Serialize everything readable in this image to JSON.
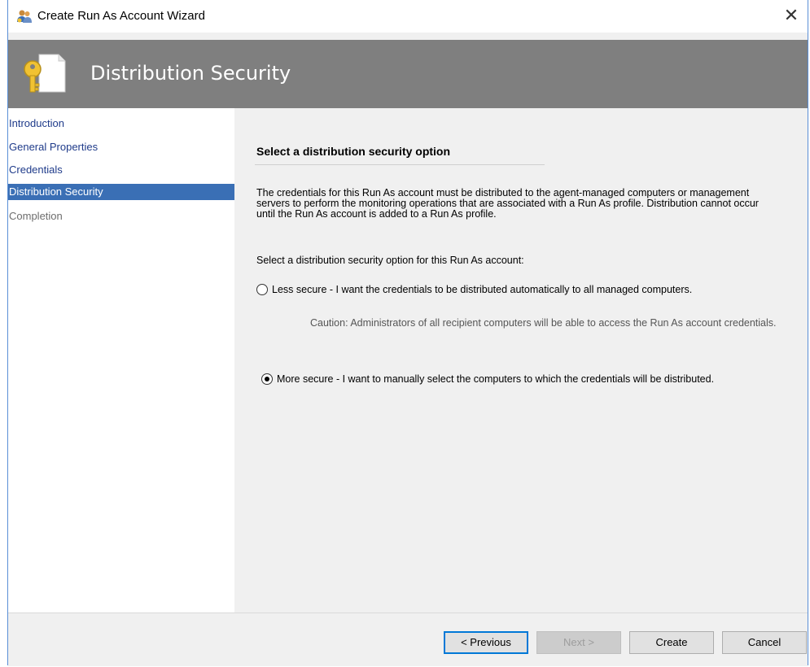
{
  "window": {
    "title": "Create Run As Account Wizard",
    "close_glyph": "✕"
  },
  "header": {
    "title": "Distribution Security",
    "icon": "key-document-icon"
  },
  "nav": {
    "items": [
      {
        "label": "Introduction",
        "state": "normal"
      },
      {
        "label": "General Properties",
        "state": "normal"
      },
      {
        "label": "Credentials",
        "state": "normal"
      },
      {
        "label": "Distribution Security",
        "state": "selected"
      },
      {
        "label": "Completion",
        "state": "disabled"
      }
    ]
  },
  "content": {
    "section_title": "Select a distribution security option",
    "description": "The credentials for this Run As account must be distributed to the agent-managed computers or management servers to perform the monitoring operations that are associated with a Run As profile. Distribution cannot occur until the Run As account is added to a Run As profile.",
    "prompt": "Select a distribution security option for this Run As account:",
    "option_less": "Less secure - I want the credentials to be distributed automatically to all managed computers.",
    "caution": "Caution: Administrators of all recipient computers will be able to access the Run As account credentials.",
    "option_more": "More secure - I want to manually select the computers to which the credentials will be distributed.",
    "selected_option": "more"
  },
  "footer": {
    "previous": "< Previous",
    "next": "Next >",
    "create": "Create",
    "cancel": "Cancel"
  },
  "colors": {
    "header_bg": "#7f7f7f",
    "nav_selected": "#3a6fb5",
    "nav_link": "#1f3b8a"
  }
}
